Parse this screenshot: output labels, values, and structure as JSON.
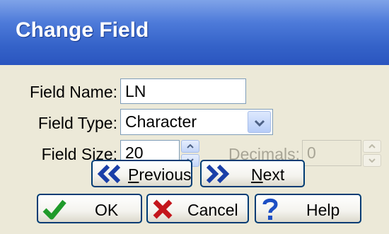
{
  "window": {
    "title": "Change Field"
  },
  "form": {
    "field_name_label": "Field Name:",
    "field_name_value": "LN",
    "field_type_label": "Field Type:",
    "field_type_value": "Character",
    "field_size_label": "Field Size:",
    "field_size_value": "20",
    "decimals_label": "Decimals:",
    "decimals_value": "0"
  },
  "nav": {
    "previous_first": "P",
    "previous_rest": "revious",
    "next_first": "N",
    "next_rest": "ext"
  },
  "actions": {
    "ok_label": "OK",
    "cancel_label": "Cancel",
    "help_label": "Help"
  },
  "colors": {
    "title_blue": "#3563c9",
    "button_border": "#003c74",
    "nav_arrow": "#1a3fa8",
    "ok_check": "#1f9a2a",
    "cancel_x": "#c4161c",
    "help_q": "#1d4fc4"
  },
  "icons": {
    "previous": "double-chevron-left-icon",
    "next": "double-chevron-right-icon",
    "ok": "checkmark-icon",
    "cancel": "x-icon",
    "help": "question-mark-icon",
    "combo": "chevron-down-icon"
  }
}
